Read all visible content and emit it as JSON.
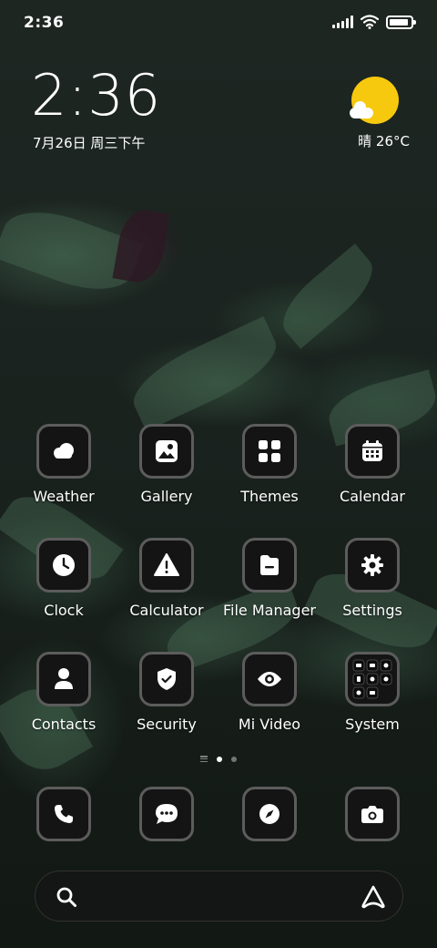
{
  "status_bar": {
    "time": "2:36",
    "battery_level": 0.9
  },
  "clock_widget": {
    "time": "2:36",
    "date": "7月26日 周三下午"
  },
  "weather_widget": {
    "condition_icon": "sun-cloud-icon",
    "text": "晴 26°C"
  },
  "home_apps": [
    {
      "label": "Weather",
      "icon": "weather-icon"
    },
    {
      "label": "Gallery",
      "icon": "gallery-icon"
    },
    {
      "label": "Themes",
      "icon": "themes-icon"
    },
    {
      "label": "Calendar",
      "icon": "calendar-icon"
    },
    {
      "label": "Clock",
      "icon": "clock-icon"
    },
    {
      "label": "Calculator",
      "icon": "calculator-icon"
    },
    {
      "label": "File Manager",
      "icon": "file-manager-icon"
    },
    {
      "label": "Settings",
      "icon": "settings-icon"
    },
    {
      "label": "Contacts",
      "icon": "contacts-icon"
    },
    {
      "label": "Security",
      "icon": "security-icon"
    },
    {
      "label": "Mi Video",
      "icon": "mi-video-icon"
    },
    {
      "label": "System",
      "icon": "system-folder-icon"
    }
  ],
  "page_indicator": {
    "current_page": 1,
    "total_pages": 2
  },
  "dock": [
    {
      "icon": "phone-icon"
    },
    {
      "icon": "messages-icon"
    },
    {
      "icon": "browser-icon"
    },
    {
      "icon": "camera-icon"
    }
  ],
  "search": {
    "left_icon": "search-icon",
    "right_icon": "assistant-icon"
  },
  "colors": {
    "icon_bg": "#141414",
    "icon_border": "#5c5c5c",
    "sun": "#f6c90e"
  }
}
